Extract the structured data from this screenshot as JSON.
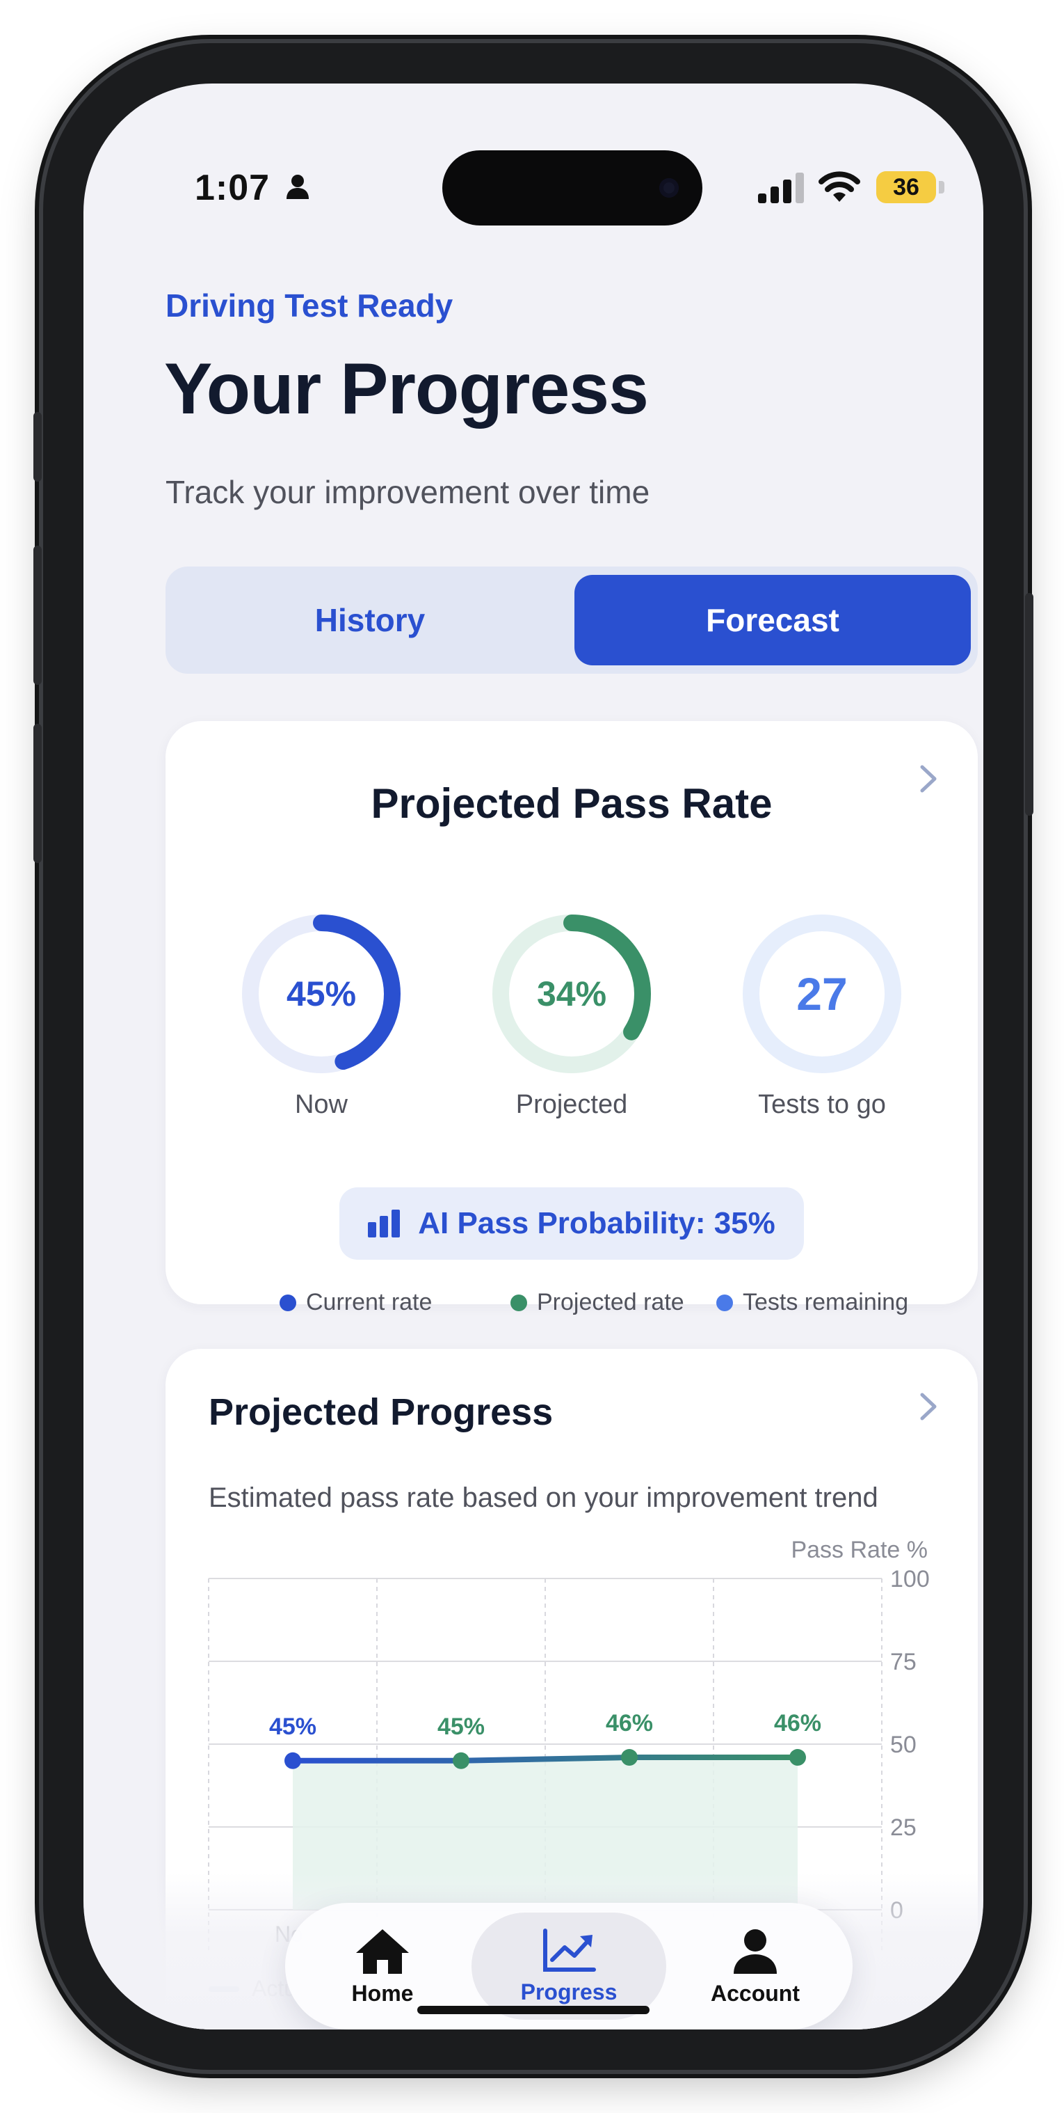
{
  "status_bar": {
    "time": "1:07",
    "battery": "36"
  },
  "header": {
    "app_name": "Driving Test Ready",
    "title": "Your Progress",
    "subtitle": "Track your improvement over time"
  },
  "segmented_control": {
    "options": [
      "History",
      "Forecast"
    ],
    "selected": "Forecast"
  },
  "pass_rate_card": {
    "title": "Projected Pass Rate",
    "stats": [
      {
        "value_text": "45%",
        "fraction": 0.45,
        "label": "Now",
        "color": "#2a50d0",
        "track": "#e8ecfa"
      },
      {
        "value_text": "34%",
        "fraction": 0.34,
        "label": "Projected",
        "color": "#3a9068",
        "track": "#e2f1ea"
      },
      {
        "value_text": "27",
        "fraction": 0,
        "label": "Tests to go",
        "color": "#4a7ae8",
        "track": "#e6eefc"
      }
    ],
    "ai_probability": "AI Pass Probability: 35%",
    "legend": [
      {
        "label": "Current rate",
        "color": "#2a50d0"
      },
      {
        "label": "Projected rate",
        "color": "#3a9068"
      },
      {
        "label": "Tests remaining",
        "color": "#4a7ae8"
      }
    ]
  },
  "progress_card": {
    "title": "Projected Progress",
    "subtitle": "Estimated pass rate based on your improvement trend"
  },
  "chart_data": {
    "type": "line",
    "ylabel": "Pass Rate %",
    "ylim": [
      0,
      100
    ],
    "y_ticks": [
      "100",
      "75",
      "50",
      "25",
      "0"
    ],
    "x_first_label_visible": "No",
    "points": [
      {
        "value": 45,
        "label": "45%",
        "color": "#2a50d0"
      },
      {
        "value": 45,
        "label": "45%",
        "color": "#3a9068"
      },
      {
        "value": 46,
        "label": "46%",
        "color": "#3a9068"
      },
      {
        "value": 46,
        "label": "46%",
        "color": "#3a9068"
      }
    ],
    "legend_visible": "Actu",
    "area_fill": "#e4f2ec",
    "grid": true
  },
  "tab_bar": {
    "tabs": [
      {
        "label": "Home",
        "icon": "house-icon"
      },
      {
        "label": "Progress",
        "icon": "trend-chart-icon"
      },
      {
        "label": "Account",
        "icon": "person-icon"
      }
    ],
    "active": "Progress"
  }
}
